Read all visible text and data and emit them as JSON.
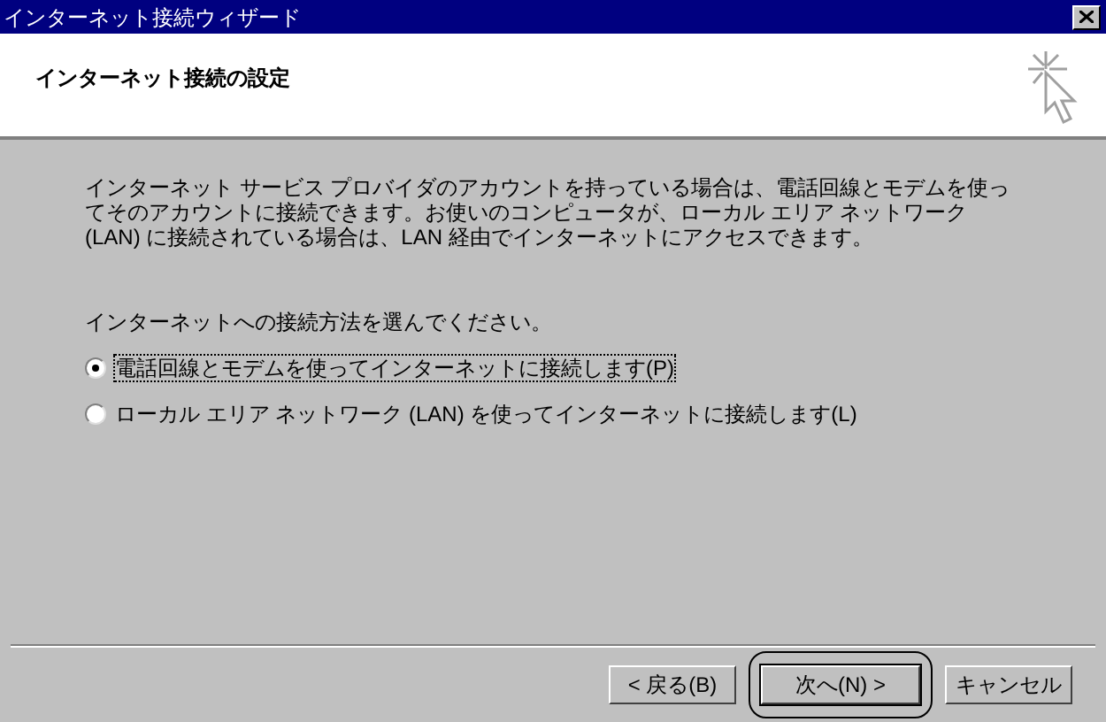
{
  "window": {
    "title": "インターネット接続ウィザード"
  },
  "header": {
    "title": "インターネット接続の設定"
  },
  "description": "インターネット サービス プロバイダのアカウントを持っている場合は、電話回線とモデムを使ってそのアカウントに接続できます。お使いのコンピュータが、ローカル エリア ネットワーク (LAN) に接続されている場合は、LAN 経由でインターネットにアクセスできます。",
  "prompt": "インターネットへの接続方法を選んでください。",
  "options": [
    {
      "label": "電話回線とモデムを使ってインターネットに接続します(P)",
      "selected": true
    },
    {
      "label": "ローカル エリア ネットワーク (LAN) を使ってインターネットに接続します(L)",
      "selected": false
    }
  ],
  "buttons": [
    {
      "label": "< 戻る(B)",
      "default": false,
      "circled": false
    },
    {
      "label": "次へ(N) >",
      "default": true,
      "circled": true
    },
    {
      "label": "キャンセル",
      "default": false,
      "circled": false
    }
  ]
}
